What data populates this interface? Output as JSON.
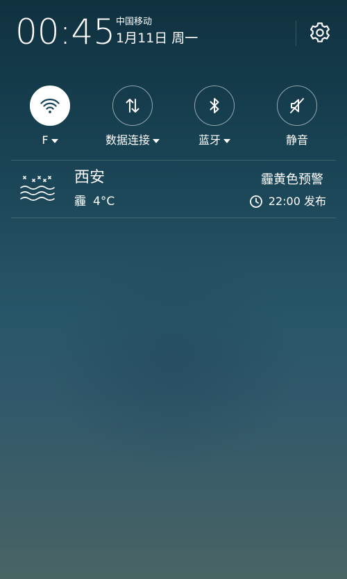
{
  "status": {
    "time": "00:45",
    "carrier": "中国移动",
    "date": "1月11日 周一"
  },
  "toggles": [
    {
      "label": "F",
      "icon": "wifi-icon",
      "active": true,
      "has_dropdown": true
    },
    {
      "label": "数据连接",
      "icon": "data-transfer-icon",
      "active": false,
      "has_dropdown": true
    },
    {
      "label": "蓝牙",
      "icon": "bluetooth-icon",
      "active": false,
      "has_dropdown": true
    },
    {
      "label": "静音",
      "icon": "mute-icon",
      "active": false,
      "has_dropdown": false
    }
  ],
  "weather": {
    "icon": "haze-icon",
    "city": "西安",
    "condition": "霾",
    "temperature": "4°C",
    "alert": "霾黄色预警",
    "publish_time": "22:00",
    "publish_label": "发布"
  },
  "colors": {
    "active_toggle_bg": "#ffffff",
    "active_icon": "#1a4556"
  }
}
